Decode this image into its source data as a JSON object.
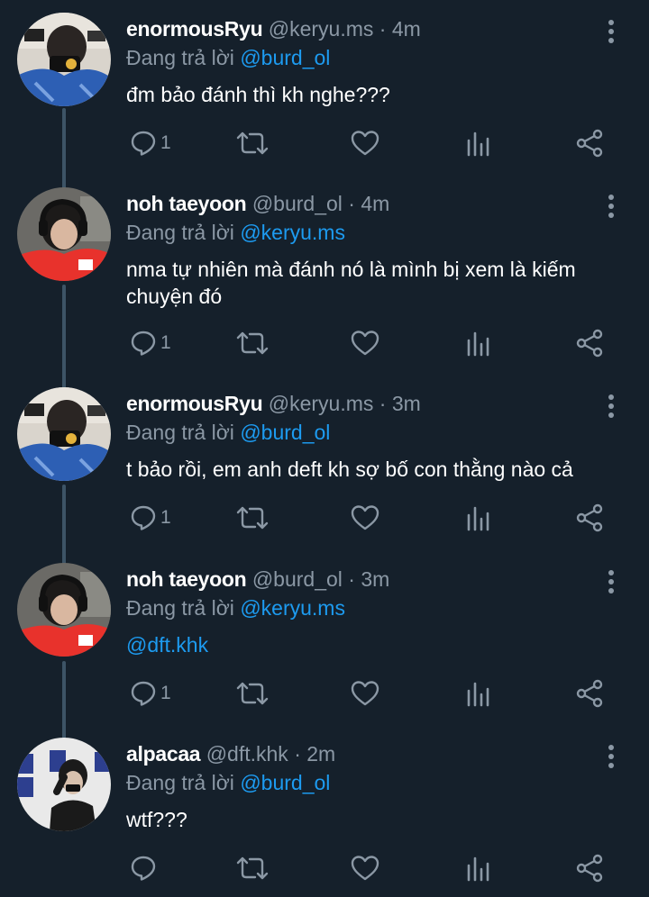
{
  "replying_prefix": "Đang trả lời",
  "tweets": [
    {
      "name": "enormousRyu",
      "handle": "@keryu.ms",
      "separator": "·",
      "time": "4m",
      "replying_to": "@burd_ol",
      "text": "đm bảo đánh thì kh nghe???",
      "reply_count": "1"
    },
    {
      "name": "noh taeyoon",
      "handle": "@burd_ol",
      "separator": "·",
      "time": "4m",
      "replying_to": "@keryu.ms",
      "text": "nma tự nhiên mà đánh nó là mình bị xem là kiếm chuyện đó",
      "reply_count": "1"
    },
    {
      "name": "enormousRyu",
      "handle": "@keryu.ms",
      "separator": "·",
      "time": "3m",
      "replying_to": "@burd_ol",
      "text": "t bảo rồi, em anh deft kh sợ bố con thằng nào cả",
      "reply_count": "1"
    },
    {
      "name": "noh taeyoon",
      "handle": "@burd_ol",
      "separator": "·",
      "time": "3m",
      "replying_to": "@keryu.ms",
      "text": "@dft.khk",
      "reply_count": "1"
    },
    {
      "name": "alpacaa",
      "handle": "@dft.khk",
      "separator": "·",
      "time": "2m",
      "replying_to": "@burd_ol",
      "text": "wtf???",
      "reply_count": ""
    }
  ],
  "icons": [
    "reply-icon",
    "retweet-icon",
    "like-icon",
    "views-icon",
    "share-icon",
    "more-options-icon"
  ],
  "colors": {
    "background": "#15202b",
    "text": "#ffffff",
    "secondary": "#8b98a5",
    "link": "#1d9bf0",
    "thread_line": "#3d5466"
  }
}
